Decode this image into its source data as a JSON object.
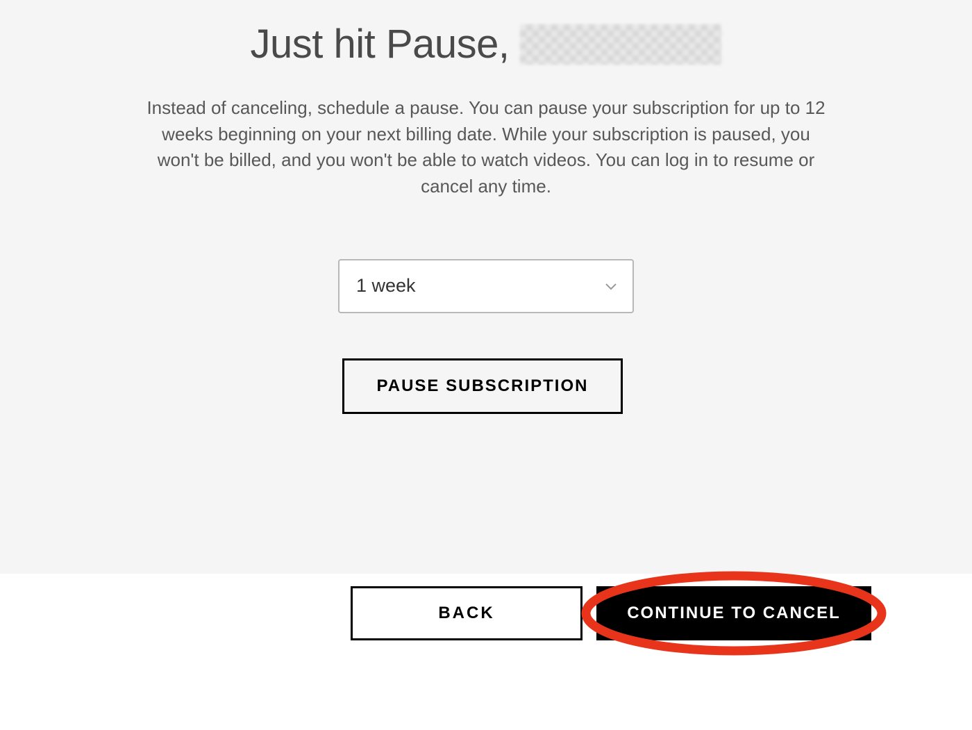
{
  "heading": {
    "prefix": "Just hit Pause,",
    "redacted_name": true
  },
  "description": "Instead of canceling, schedule a pause. You can pause your subscription for up to 12 weeks beginning on your next billing date. While your subscription is paused, you won't be billed, and you won't be able to watch videos. You can log in to resume or cancel any time.",
  "duration_select": {
    "selected_label": "1 week"
  },
  "buttons": {
    "pause_label": "PAUSE SUBSCRIPTION",
    "back_label": "BACK",
    "continue_label": "CONTINUE TO CANCEL"
  },
  "highlight_color": "#e8341b"
}
